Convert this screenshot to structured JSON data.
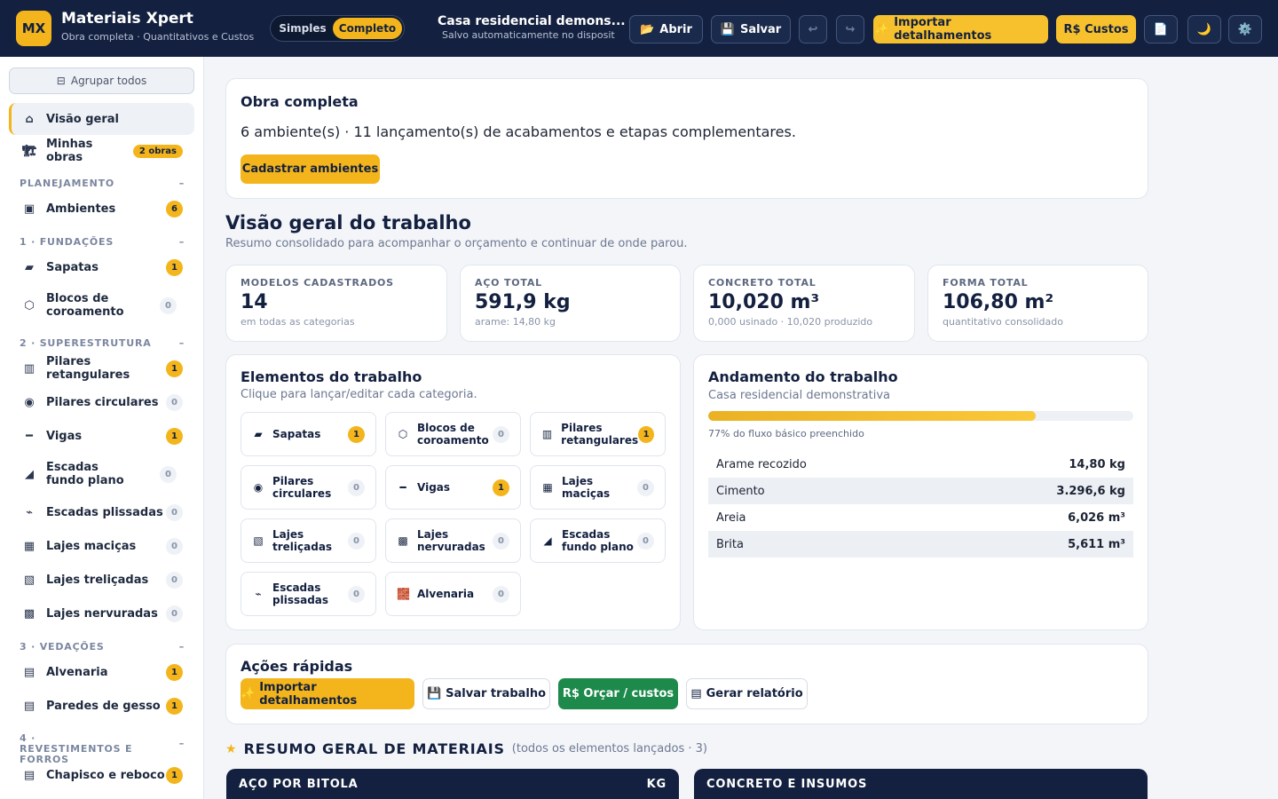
{
  "header": {
    "logo": "MX",
    "title": "Materiais Xpert",
    "subtitle": "Obra completa · Quantitativos e Custos",
    "mode_simple": "Simples",
    "mode_full": "Completo",
    "project_title": "Casa residencial demons...",
    "project_sub": "Salvo automaticamente no disposit",
    "open_icon": "📂",
    "open_label": "Abrir",
    "save_icon": "💾",
    "save_label": "Salvar",
    "undo": "↩",
    "redo": "↪",
    "import_icon": "✨",
    "import_label": "Importar detalhamentos",
    "costs_label": "R$ Custos",
    "report_icon": "📄",
    "theme_icon": "🌙",
    "settings_icon": "⚙️"
  },
  "sidebar": {
    "group_icon": "⊟",
    "group_label": "Agrupar todos",
    "overview": {
      "icon": "⌂",
      "label": "Visão geral"
    },
    "my_works": {
      "icon": "🏗",
      "label": "Minhas obras",
      "badge": "2 obras"
    },
    "sections": [
      {
        "title": "PLANEJAMENTO",
        "toggle": "–"
      },
      {
        "title": "1 · FUNDAÇÕES",
        "toggle": "–"
      },
      {
        "title": "2 · SUPERESTRUTURA",
        "toggle": "–"
      },
      {
        "title": "3 · VEDAÇÕES",
        "toggle": "–"
      },
      {
        "title": "4 · REVESTIMENTOS E FORROS",
        "toggle": "–"
      }
    ],
    "items": [
      {
        "icon": "▣",
        "label": "Ambientes",
        "count": "6",
        "active": true
      },
      {
        "icon": "▰",
        "label": "Sapatas",
        "count": "1",
        "active": true
      },
      {
        "icon": "⬡",
        "label": "Blocos de coroamento",
        "count": "0",
        "active": false
      },
      {
        "icon": "▥",
        "label": "Pilares retangulares",
        "count": "1",
        "active": true
      },
      {
        "icon": "◉",
        "label": "Pilares circulares",
        "count": "0",
        "active": false
      },
      {
        "icon": "━",
        "label": "Vigas",
        "count": "1",
        "active": true
      },
      {
        "icon": "◢",
        "label": "Escadas fundo plano",
        "count": "0",
        "active": false
      },
      {
        "icon": "⌁",
        "label": "Escadas plissadas",
        "count": "0",
        "active": false
      },
      {
        "icon": "▦",
        "label": "Lajes maciças",
        "count": "0",
        "active": false
      },
      {
        "icon": "▧",
        "label": "Lajes treliçadas",
        "count": "0",
        "active": false
      },
      {
        "icon": "▩",
        "label": "Lajes nervuradas",
        "count": "0",
        "active": false
      },
      {
        "icon": "▤",
        "label": "Alvenaria",
        "count": "1",
        "active": true
      },
      {
        "icon": "▤",
        "label": "Paredes de gesso",
        "count": "1",
        "active": true
      },
      {
        "icon": "▤",
        "label": "Chapisco e reboco",
        "count": "1",
        "active": true
      }
    ]
  },
  "obra": {
    "title": "Obra completa",
    "summary": "6 ambiente(s) · 11 lançamento(s) de acabamentos e etapas complementares.",
    "button": "Cadastrar ambientes"
  },
  "overview": {
    "title": "Visão geral do trabalho",
    "subtitle": "Resumo consolidado para acompanhar o orçamento e continuar de onde parou."
  },
  "stats": [
    {
      "label": "MODELOS CADASTRADOS",
      "value": "14",
      "foot": "em todas as categorias"
    },
    {
      "label": "AÇO TOTAL",
      "value": "591,9 kg",
      "foot": "arame: 14,80 kg"
    },
    {
      "label": "CONCRETO TOTAL",
      "value": "10,020 m³",
      "foot": "0,000 usinado · 10,020 produzido"
    },
    {
      "label": "FORMA TOTAL",
      "value": "106,80 m²",
      "foot": "quantitativo consolidado"
    }
  ],
  "elements": {
    "title": "Elementos do trabalho",
    "subtitle": "Clique para lançar/editar cada categoria.",
    "tiles": [
      {
        "icon": "▰",
        "label": "Sapatas",
        "count": "1",
        "active": true
      },
      {
        "icon": "⬡",
        "label": "Blocos de coroamento",
        "count": "0",
        "active": false
      },
      {
        "icon": "▥",
        "label": "Pilares retangulares",
        "count": "1",
        "active": true
      },
      {
        "icon": "◉",
        "label": "Pilares circulares",
        "count": "0",
        "active": false
      },
      {
        "icon": "━",
        "label": "Vigas",
        "count": "1",
        "active": true
      },
      {
        "icon": "▦",
        "label": "Lajes maciças",
        "count": "0",
        "active": false
      },
      {
        "icon": "▧",
        "label": "Lajes treliçadas",
        "count": "0",
        "active": false
      },
      {
        "icon": "▩",
        "label": "Lajes nervuradas",
        "count": "0",
        "active": false
      },
      {
        "icon": "◢",
        "label": "Escadas fundo plano",
        "count": "0",
        "active": false
      },
      {
        "icon": "⌁",
        "label": "Escadas plissadas",
        "count": "0",
        "active": false
      },
      {
        "icon": "🧱",
        "label": "Alvenaria",
        "count": "0",
        "active": false
      }
    ]
  },
  "progress": {
    "title": "Andamento do trabalho",
    "subtitle": "Casa residencial demonstrativa",
    "percent": 77,
    "caption": "77% do fluxo básico preenchido",
    "rows": [
      {
        "name": "Arame recozido",
        "value": "14,80 kg"
      },
      {
        "name": "Cimento",
        "value": "3.296,6 kg"
      },
      {
        "name": "Areia",
        "value": "6,026 m³"
      },
      {
        "name": "Brita",
        "value": "5,611 m³"
      }
    ]
  },
  "quick": {
    "title": "Ações rápidas",
    "import_icon": "✨",
    "import": "Importar detalhamentos",
    "save_icon": "💾",
    "save": "Salvar trabalho",
    "budget": "R$ Orçar / custos",
    "report_icon": "▤",
    "report": "Gerar relatório"
  },
  "summary": {
    "star": "★",
    "title": "RESUMO GERAL DE MATERIAIS",
    "note": "(todos os elementos lançados · 3)",
    "steel_head": "AÇO POR BITOLA",
    "steel_unit": "KG",
    "concrete_head": "CONCRETO E INSUMOS"
  },
  "colors": {
    "navy": "#13203f",
    "gold": "#f3b51b",
    "green": "#1d8a4c",
    "background": "#f3f5f9"
  }
}
